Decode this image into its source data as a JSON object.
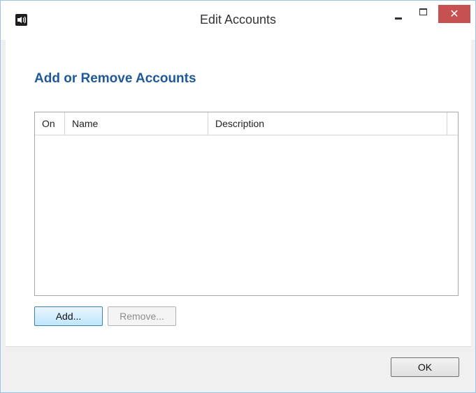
{
  "window": {
    "title": "Edit Accounts",
    "close_glyph": "✕",
    "app_icon": "speaker-app-icon"
  },
  "main": {
    "heading": "Add or Remove Accounts",
    "columns": [
      "On",
      "Name",
      "Description"
    ],
    "rows": [],
    "add_label": "Add...",
    "remove_label": "Remove..."
  },
  "footer": {
    "ok_label": "OK"
  },
  "colors": {
    "heading": "#1f5a97",
    "close_button": "#c75050",
    "window_border": "#9ec3e6"
  }
}
